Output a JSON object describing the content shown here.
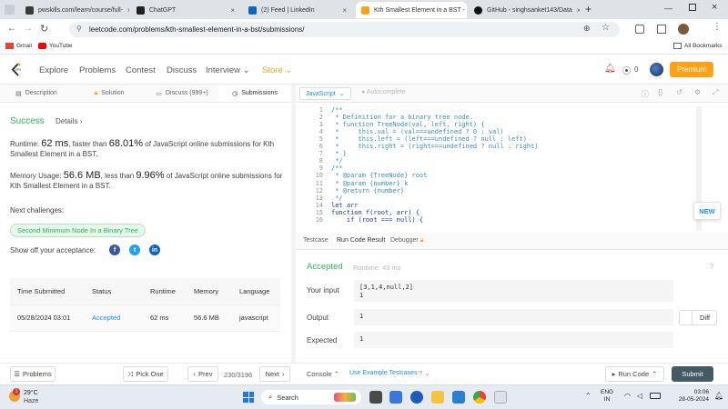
{
  "browser": {
    "tabs": [
      {
        "title": "pwskills.com/learn/course/full-"
      },
      {
        "title": "ChatGPT"
      },
      {
        "title": "(2) Feed | LinkedIn"
      },
      {
        "title": "Kth Smallest Element in a BST -"
      },
      {
        "title": "GitHub - singhsanket143/Data"
      }
    ],
    "url": "leetcode.com/problems/kth-smallest-element-in-a-bst/submissions/",
    "bookmarks": [
      "Gmail",
      "YouTube"
    ],
    "all_bookmarks": "All Bookmarks"
  },
  "nav": {
    "links": [
      "Explore",
      "Problems",
      "Contest",
      "Discuss",
      "Interview",
      "Store"
    ],
    "notif_count": "0",
    "premium": "Premium"
  },
  "left_tabs": [
    "Description",
    "Solution",
    "Discuss (999+)",
    "Submissions"
  ],
  "result": {
    "status": "Success",
    "details": "Details",
    "runtime_label": "Runtime:",
    "runtime_value": "62 ms",
    "runtime_mid": ", faster than",
    "runtime_pct": "68.01%",
    "runtime_tail": "of JavaScript online submissions for Kth Smallest Element in a BST.",
    "memory_label": "Memory Usage:",
    "memory_value": "56.6 MB",
    "memory_mid": ", less than",
    "memory_pct": "9.96%",
    "memory_tail": "of JavaScript online submissions for Kth Smallest Element in a BST.",
    "next_label": "Next challenges:",
    "next_challenge": "Second Minimum Node In a Binary Tree",
    "share_label": "Show off your acceptance:"
  },
  "submissions": {
    "headers": [
      "Time Submitted",
      "Status",
      "Runtime",
      "Memory",
      "Language"
    ],
    "rows": [
      [
        "05/28/2024 03:01",
        "Accepted",
        "62 ms",
        "56.6 MB",
        "javascript"
      ]
    ]
  },
  "editor": {
    "language": "JavaScript",
    "autocomplete": "Autocomplete",
    "line_numbers": [
      "1",
      "2",
      "3",
      "4",
      "5",
      "6",
      "7",
      "8",
      "9",
      "10",
      "11",
      "12",
      "13",
      "14",
      "15",
      "16"
    ],
    "lines": [
      "/**",
      " * Definition for a binary tree node.",
      " * function TreeNode(val, left, right) {",
      " *     this.val = (val===undefined ? 0 : val)",
      " *     this.left = (left===undefined ? null : left)",
      " *     this.right = (right===undefined ? null : right)",
      " * }",
      " */",
      "/**",
      " * @param {TreeNode} root",
      " * @param {number} k",
      " * @return {number}",
      " */",
      "let arr",
      "function f(root, arr) {",
      "    if (root === null) {"
    ]
  },
  "new_badge": "NEW",
  "console": {
    "tabs": [
      "Testcase",
      "Run Code Result",
      "Debugger"
    ],
    "status": "Accepted",
    "runtime": "Runtime: 43 ms",
    "input_label": "Your input",
    "input_value": "[3,1,4,null,2]",
    "input_k": "1",
    "output_label": "Output",
    "output_value": "1",
    "diff": "Diff",
    "expected_label": "Expected",
    "expected_value": "1"
  },
  "bottom": {
    "problems": "Problems",
    "pick_one": "Pick One",
    "prev": "Prev",
    "page": "230/3196",
    "next": "Next",
    "console": "Console",
    "use_example": "Use Example Testcases",
    "run_code": "Run Code",
    "submit": "Submit"
  },
  "taskbar": {
    "weather_temp": "29°C",
    "weather_desc": "Haze",
    "search": "Search",
    "lang1": "ENG",
    "lang2": "IN",
    "time": "03:06",
    "date": "28-05-2024",
    "badge": "1"
  },
  "colors": {
    "accent": "#ffa116",
    "success": "#2db55d",
    "link": "#1a90ff"
  }
}
